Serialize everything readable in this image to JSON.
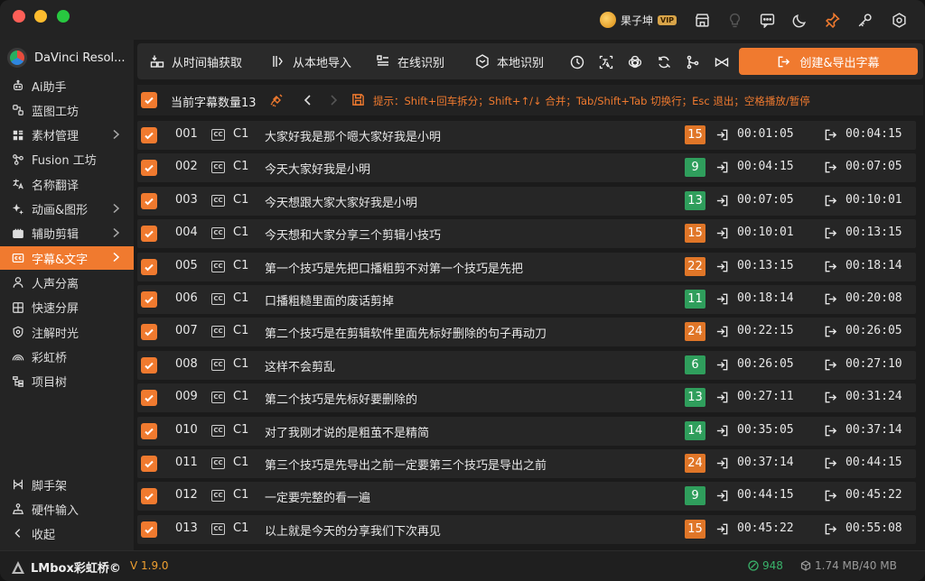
{
  "colors": {
    "accent": "#f07a2f",
    "badge_orange": "#e07628",
    "badge_green": "#2f9e5c",
    "version": "#f0a030",
    "points": "#39b26a"
  },
  "user": {
    "name": "果子坤",
    "badge": "VIP"
  },
  "topbar_icons": [
    "store-icon",
    "bulb-icon",
    "chat-icon",
    "moon-icon",
    "pin-icon",
    "key-icon",
    "settings-icon"
  ],
  "sidebar": {
    "title": "DaVinci Resol...",
    "items": [
      {
        "label": "Ai助手",
        "icon": "ai-icon"
      },
      {
        "label": "蓝图工坊",
        "icon": "blueprint-icon"
      },
      {
        "label": "素材管理",
        "icon": "media-icon",
        "chevron": true
      },
      {
        "label": "Fusion 工坊",
        "icon": "fusion-icon"
      },
      {
        "label": "名称翻译",
        "icon": "translate-icon"
      },
      {
        "label": "动画&图形",
        "icon": "animation-icon",
        "chevron": true
      },
      {
        "label": "辅助剪辑",
        "icon": "edit-icon",
        "chevron": true
      },
      {
        "label": "字幕&文字",
        "icon": "subtitle-icon",
        "chevron": true,
        "active": true
      },
      {
        "label": "人声分离",
        "icon": "voice-icon"
      },
      {
        "label": "快速分屏",
        "icon": "split-icon"
      },
      {
        "label": "注解时光",
        "icon": "note-icon"
      },
      {
        "label": "彩虹桥",
        "icon": "rainbow-icon"
      },
      {
        "label": "项目树",
        "icon": "tree-icon"
      }
    ],
    "bottom": [
      {
        "label": "脚手架",
        "icon": "scaffold-icon"
      },
      {
        "label": "硬件输入",
        "icon": "hardware-icon"
      },
      {
        "label": "收起",
        "icon": "collapse-icon"
      }
    ]
  },
  "toolbar": {
    "from_timeline": "从时间轴获取",
    "from_local": "从本地导入",
    "online_recognize": "在线识别",
    "local_recognize": "本地识别",
    "export": "创建&导出字幕"
  },
  "status": {
    "count_label": "当前字幕数量13",
    "hint": "提示：Shift+回车拆分；Shift+↑/↓ 合并；Tab/Shift+Tab 切换行；Esc 退出；空格播放/暂停"
  },
  "subtitles": [
    {
      "num": "001",
      "track": "C1",
      "text": "大家好我是那个嗯大家好我是小明",
      "chars": "15",
      "color": "orange",
      "start": "00:01:05",
      "end": "00:04:15"
    },
    {
      "num": "002",
      "track": "C1",
      "text": "今天大家好我是小明",
      "chars": "9",
      "color": "green",
      "start": "00:04:15",
      "end": "00:07:05"
    },
    {
      "num": "003",
      "track": "C1",
      "text": "今天想跟大家大家好我是小明",
      "chars": "13",
      "color": "green",
      "start": "00:07:05",
      "end": "00:10:01"
    },
    {
      "num": "004",
      "track": "C1",
      "text": "今天想和大家分享三个剪辑小技巧",
      "chars": "15",
      "color": "orange",
      "start": "00:10:01",
      "end": "00:13:15"
    },
    {
      "num": "005",
      "track": "C1",
      "text": "第一个技巧是先把口播粗剪不对第一个技巧是先把",
      "chars": "22",
      "color": "orange",
      "start": "00:13:15",
      "end": "00:18:14"
    },
    {
      "num": "006",
      "track": "C1",
      "text": "口播粗糙里面的废话剪掉",
      "chars": "11",
      "color": "green",
      "start": "00:18:14",
      "end": "00:20:08"
    },
    {
      "num": "007",
      "track": "C1",
      "text": "第二个技巧是在剪辑软件里面先标好删除的句子再动刀",
      "chars": "24",
      "color": "orange",
      "start": "00:22:15",
      "end": "00:26:05"
    },
    {
      "num": "008",
      "track": "C1",
      "text": "这样不会剪乱",
      "chars": "6",
      "color": "green",
      "start": "00:26:05",
      "end": "00:27:10"
    },
    {
      "num": "009",
      "track": "C1",
      "text": "第二个技巧是先标好要删除的",
      "chars": "13",
      "color": "green",
      "start": "00:27:11",
      "end": "00:31:24"
    },
    {
      "num": "010",
      "track": "C1",
      "text": "对了我刚才说的是粗茧不是精简",
      "chars": "14",
      "color": "green",
      "start": "00:35:05",
      "end": "00:37:14"
    },
    {
      "num": "011",
      "track": "C1",
      "text": "第三个技巧是先导出之前一定要第三个技巧是导出之前",
      "chars": "24",
      "color": "orange",
      "start": "00:37:14",
      "end": "00:44:15"
    },
    {
      "num": "012",
      "track": "C1",
      "text": "一定要完整的看一遍",
      "chars": "9",
      "color": "green",
      "start": "00:44:15",
      "end": "00:45:22"
    },
    {
      "num": "013",
      "track": "C1",
      "text": "以上就是今天的分享我们下次再见",
      "chars": "15",
      "color": "orange",
      "start": "00:45:22",
      "end": "00:55:08"
    }
  ],
  "footer": {
    "brand": "LMbox彩虹桥©",
    "version": "V 1.9.0",
    "points": "948",
    "memory": "1.74 MB/40 MB"
  }
}
